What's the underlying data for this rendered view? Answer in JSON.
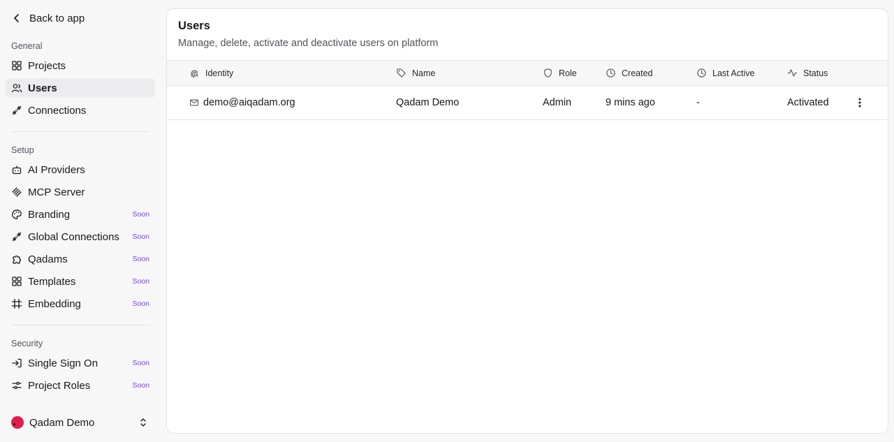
{
  "sidebar": {
    "back_label": "Back to app",
    "sections": {
      "general": "General",
      "setup": "Setup",
      "security": "Security"
    },
    "general_items": [
      {
        "label": "Projects",
        "icon": "grid-icon"
      },
      {
        "label": "Users",
        "icon": "users-icon",
        "active": true
      },
      {
        "label": "Connections",
        "icon": "plug-icon"
      }
    ],
    "setup_items": [
      {
        "label": "AI Providers",
        "icon": "bot-icon"
      },
      {
        "label": "MCP Server",
        "icon": "mcp-icon"
      },
      {
        "label": "Branding",
        "icon": "palette-icon",
        "badge": "Soon"
      },
      {
        "label": "Global Connections",
        "icon": "plug-icon",
        "badge": "Soon"
      },
      {
        "label": "Qadams",
        "icon": "puzzle-icon",
        "badge": "Soon"
      },
      {
        "label": "Templates",
        "icon": "grid-icon",
        "badge": "Soon"
      },
      {
        "label": "Embedding",
        "icon": "hash-frame-icon",
        "badge": "Soon"
      }
    ],
    "security_items": [
      {
        "label": "Single Sign On",
        "icon": "sign-in-icon",
        "badge": "Soon"
      },
      {
        "label": "Project Roles",
        "icon": "sliders-icon",
        "badge": "Soon"
      }
    ],
    "footer": {
      "name": "Qadam Demo"
    }
  },
  "main": {
    "title": "Users",
    "subtitle": "Manage, delete, activate and deactivate users on platform",
    "columns": [
      {
        "label": "Identity",
        "icon": "fingerprint-icon"
      },
      {
        "label": "Name",
        "icon": "tag-icon"
      },
      {
        "label": "Role",
        "icon": "shield-icon"
      },
      {
        "label": "Created",
        "icon": "clock-icon"
      },
      {
        "label": "Last Active",
        "icon": "clock-icon"
      },
      {
        "label": "Status",
        "icon": "activity-icon"
      }
    ],
    "rows": [
      {
        "identity": "demo@aiqadam.org",
        "name": "Qadam Demo",
        "role": "Admin",
        "created": "9 mins ago",
        "last_active": "-",
        "status": "Activated"
      }
    ]
  },
  "colors": {
    "accent_soon": "#7c3aed",
    "avatar": "#e11d48",
    "active_bg": "#ececee"
  }
}
